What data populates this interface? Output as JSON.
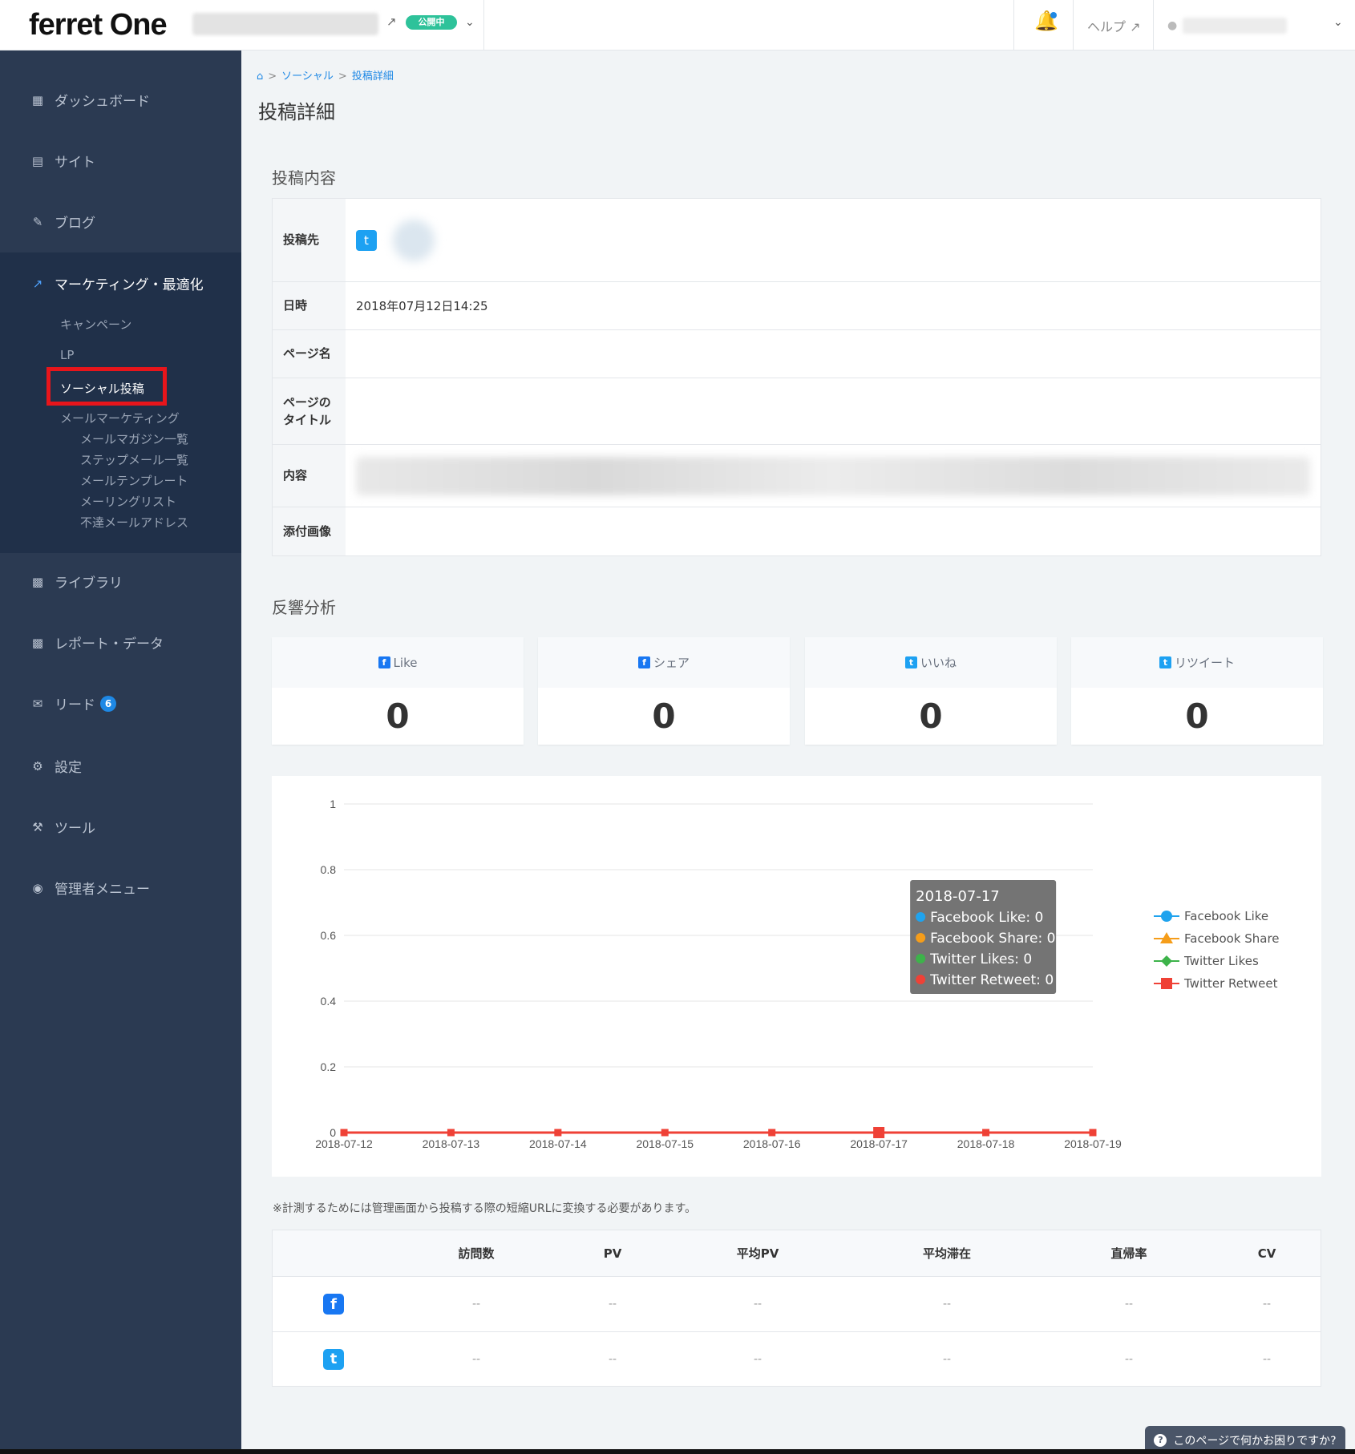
{
  "header": {
    "logo": "ferret One",
    "status": "公開中",
    "help": "ヘルプ",
    "ext_icon": "external-link-icon"
  },
  "sidebar": {
    "items": [
      {
        "label": "ダッシュボード",
        "icon": "dashboard-icon"
      },
      {
        "label": "サイト",
        "icon": "site-icon"
      },
      {
        "label": "ブログ",
        "icon": "pencil-icon"
      },
      {
        "label": "マーケティング・最適化",
        "icon": "trend-icon"
      },
      {
        "label": "ライブラリ",
        "icon": "image-icon"
      },
      {
        "label": "レポート・データ",
        "icon": "bar-chart-icon"
      },
      {
        "label": "リード",
        "icon": "mail-icon",
        "badge": "6"
      },
      {
        "label": "設定",
        "icon": "gear-icon"
      },
      {
        "label": "ツール",
        "icon": "wrench-icon"
      },
      {
        "label": "管理者メニュー",
        "icon": "user-circle-icon"
      }
    ],
    "sub": [
      "キャンペーン",
      "LP",
      "ソーシャル投稿",
      "メールマーケティング"
    ],
    "sub2": [
      "メールマガジン一覧",
      "ステップメール一覧",
      "メールテンプレート",
      "メーリングリスト",
      "不達メールアドレス"
    ]
  },
  "breadcrumb": {
    "home_icon": "home-icon",
    "c1": "ソーシャル",
    "c2": "投稿詳細"
  },
  "page_title": "投稿詳細",
  "section_post": "投稿内容",
  "detail": {
    "dest_label": "投稿先",
    "date_label": "日時",
    "date_value": "2018年07月12日14:25",
    "page_name_label": "ページ名",
    "page_title_label": "ページの\nタイトル",
    "content_label": "内容",
    "attachment_label": "添付画像"
  },
  "section_analysis": "反響分析",
  "stats": [
    {
      "label": "Like",
      "value": "0",
      "icon": "facebook-icon"
    },
    {
      "label": "シェア",
      "value": "0",
      "icon": "facebook-icon"
    },
    {
      "label": "いいね",
      "value": "0",
      "icon": "twitter-icon"
    },
    {
      "label": "リツイート",
      "value": "0",
      "icon": "twitter-icon"
    }
  ],
  "chart_data": {
    "type": "line",
    "x": [
      "2018-07-12",
      "2018-07-13",
      "2018-07-14",
      "2018-07-15",
      "2018-07-16",
      "2018-07-17",
      "2018-07-18",
      "2018-07-19"
    ],
    "ylim": [
      0,
      1
    ],
    "yticks": [
      "1",
      "0.8",
      "0.6",
      "0.4",
      "0.2",
      "0"
    ],
    "series": [
      {
        "name": "Facebook Like",
        "values": [
          0,
          0,
          0,
          0,
          0,
          0,
          0,
          0
        ],
        "color": "#1fa3ee"
      },
      {
        "name": "Facebook Share",
        "values": [
          0,
          0,
          0,
          0,
          0,
          0,
          0,
          0
        ],
        "color": "#f59d1a"
      },
      {
        "name": "Twitter Likes",
        "values": [
          0,
          0,
          0,
          0,
          0,
          0,
          0,
          0
        ],
        "color": "#3db34a"
      },
      {
        "name": "Twitter Retweet",
        "values": [
          0,
          0,
          0,
          0,
          0,
          0,
          0,
          0
        ],
        "color": "#ef4136"
      }
    ],
    "tooltip": {
      "title": "2018-07-17",
      "lines": [
        "Facebook Like: 0",
        "Facebook Share: 0",
        "Twitter Likes: 0",
        "Twitter Retweet: 0"
      ]
    },
    "legend_position": "right",
    "grid": true
  },
  "note": "※計測するためには管理画面から投稿する際の短縮URLに変換する必要があります。",
  "metrics": {
    "headers": [
      "訪問数",
      "PV",
      "平均PV",
      "平均滞在",
      "直帰率",
      "CV"
    ],
    "rows": [
      {
        "icon": "facebook-icon",
        "cells": [
          "--",
          "--",
          "--",
          "--",
          "--",
          "--"
        ]
      },
      {
        "icon": "twitter-icon",
        "cells": [
          "--",
          "--",
          "--",
          "--",
          "--",
          "--"
        ]
      }
    ]
  },
  "help_button": "このページで何かお困りですか?"
}
